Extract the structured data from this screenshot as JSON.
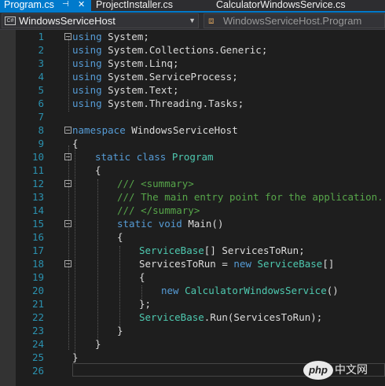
{
  "tabs": [
    {
      "label": "Program.cs",
      "active": true,
      "pin_icon": "pin-icon",
      "close_icon": "close-icon"
    },
    {
      "label": "ProjectInstaller.cs",
      "active": false
    },
    {
      "label": "CalculatorWindowsService.cs",
      "active": false
    }
  ],
  "navbar": {
    "project_combo": {
      "icon": "csharp-project-icon",
      "label": "WindowsServiceHost"
    },
    "member_combo": {
      "icon": "class-icon",
      "label": "WindowsServiceHost.Program"
    }
  },
  "editor": {
    "lines": [
      {
        "n": "1"
      },
      {
        "n": "2"
      },
      {
        "n": "3"
      },
      {
        "n": "4"
      },
      {
        "n": "5"
      },
      {
        "n": "6"
      },
      {
        "n": "7"
      },
      {
        "n": "8"
      },
      {
        "n": "9"
      },
      {
        "n": "10"
      },
      {
        "n": "11"
      },
      {
        "n": "12"
      },
      {
        "n": "13"
      },
      {
        "n": "14"
      },
      {
        "n": "15"
      },
      {
        "n": "16"
      },
      {
        "n": "17"
      },
      {
        "n": "18"
      },
      {
        "n": "19"
      },
      {
        "n": "20"
      },
      {
        "n": "21"
      },
      {
        "n": "22"
      },
      {
        "n": "23"
      },
      {
        "n": "24"
      },
      {
        "n": "25"
      },
      {
        "n": "26"
      }
    ],
    "code": {
      "l1": [
        "using",
        " System;"
      ],
      "l2": [
        "using",
        " System.Collections.Generic;"
      ],
      "l3": [
        "using",
        " System.Linq;"
      ],
      "l4": [
        "using",
        " System.ServiceProcess;"
      ],
      "l5": [
        "using",
        " System.Text;"
      ],
      "l6": [
        "using",
        " System.Threading.Tasks;"
      ],
      "l8": [
        "namespace",
        " WindowsServiceHost"
      ],
      "l9": "{",
      "l10": [
        "static",
        "class",
        "Program"
      ],
      "l11": "{",
      "l12": "/// <summary>",
      "l13": "/// The main entry point for the application.",
      "l14": "/// </summary>",
      "l15": [
        "static",
        "void",
        " Main()"
      ],
      "l16": "{",
      "l17": [
        "ServiceBase",
        "[] ServicesToRun;"
      ],
      "l18": [
        "ServicesToRun = ",
        "new",
        "ServiceBase",
        "[]"
      ],
      "l19": "{",
      "l20": [
        "new",
        "CalculatorWindowsService",
        "()"
      ],
      "l21": "};",
      "l22": [
        "ServiceBase",
        ".Run(ServicesToRun);"
      ],
      "l23": "}",
      "l24": "}",
      "l25": "}"
    }
  },
  "watermark": {
    "logo": "php",
    "text": "中文网"
  },
  "colors": {
    "keyword": "#569cd6",
    "type": "#4ec9b0",
    "comment": "#57a64a",
    "text": "#dcdcdc",
    "line_number": "#2b91af",
    "accent": "#007acc",
    "background": "#1e1e1e"
  }
}
